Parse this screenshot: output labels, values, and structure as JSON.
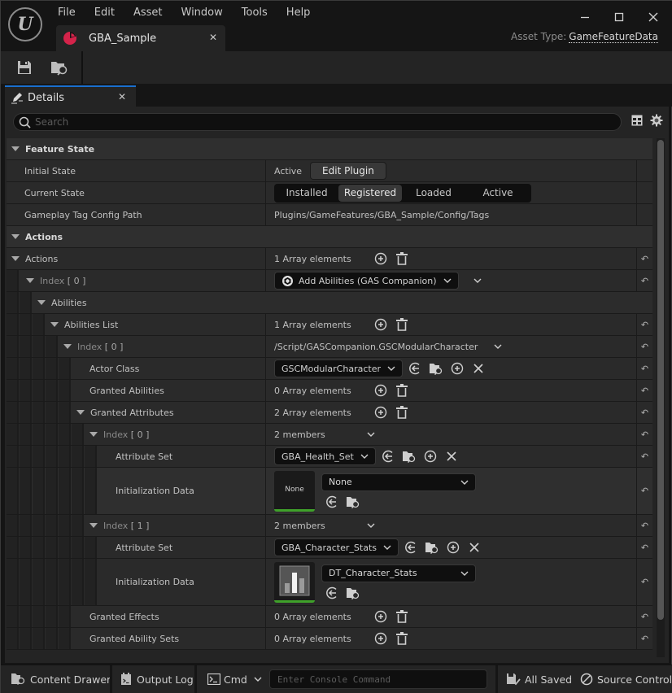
{
  "titlebar": {
    "menu": [
      "File",
      "Edit",
      "Asset",
      "Window",
      "Tools",
      "Help"
    ],
    "document_tab": "GBA_Sample",
    "asset_type_label": "Asset Type:",
    "asset_type_value": "GameFeatureData",
    "accent_color": "#d4234a"
  },
  "details_tab": {
    "label": "Details"
  },
  "search": {
    "placeholder": "Search",
    "value": ""
  },
  "feature_state": {
    "category": "Feature State",
    "initial_state_label": "Initial State",
    "initial_state_value": "Active",
    "edit_plugin_label": "Edit Plugin",
    "current_state_label": "Current State",
    "states": [
      "Installed",
      "Registered",
      "Loaded",
      "Active"
    ],
    "selected_state": "Registered",
    "tag_config_label": "Gameplay Tag Config Path",
    "tag_config_value": "Plugins/GameFeatures/GBA_Sample/Config/Tags"
  },
  "actions": {
    "category": "Actions",
    "actions_label": "Actions",
    "actions_count": "1 Array elements",
    "index0_label": "Index",
    "index0_num": "[ 0 ]",
    "action_type": "Add Abilities (GAS Companion)",
    "abilities_label": "Abilities",
    "abilities_list_label": "Abilities List",
    "abilities_list_count": "1 Array elements",
    "entry_index_label": "Index",
    "entry_index_num": "[ 0 ]",
    "entry_class_path": "/Script/GASCompanion.GSCModularCharacter",
    "actor_class_label": "Actor Class",
    "actor_class_value": "GSCModularCharacter",
    "granted_abilities_label": "Granted Abilities",
    "granted_abilities_count": "0 Array elements",
    "granted_attributes_label": "Granted Attributes",
    "granted_attributes_count": "2 Array elements",
    "attributes": [
      {
        "index_label": "Index",
        "index_num": "[ 0 ]",
        "members": "2 members",
        "attribute_set_label": "Attribute Set",
        "attribute_set_value": "GBA_Health_Set",
        "init_data_label": "Initialization Data",
        "init_data_value": "None",
        "thumbnail_text": "None"
      },
      {
        "index_label": "Index",
        "index_num": "[ 1 ]",
        "members": "2 members",
        "attribute_set_label": "Attribute Set",
        "attribute_set_value": "GBA_Character_Stats",
        "init_data_label": "Initialization Data",
        "init_data_value": "DT_Character_Stats",
        "thumbnail_text": ""
      }
    ],
    "granted_effects_label": "Granted Effects",
    "granted_effects_count": "0 Array elements",
    "granted_ability_sets_label": "Granted Ability Sets",
    "granted_ability_sets_count": "0 Array elements"
  },
  "statusbar": {
    "content_drawer": "Content Drawer",
    "output_log": "Output Log",
    "cmd": "Cmd",
    "console_placeholder": "Enter Console Command",
    "all_saved": "All Saved",
    "source_control": "Source Control"
  }
}
